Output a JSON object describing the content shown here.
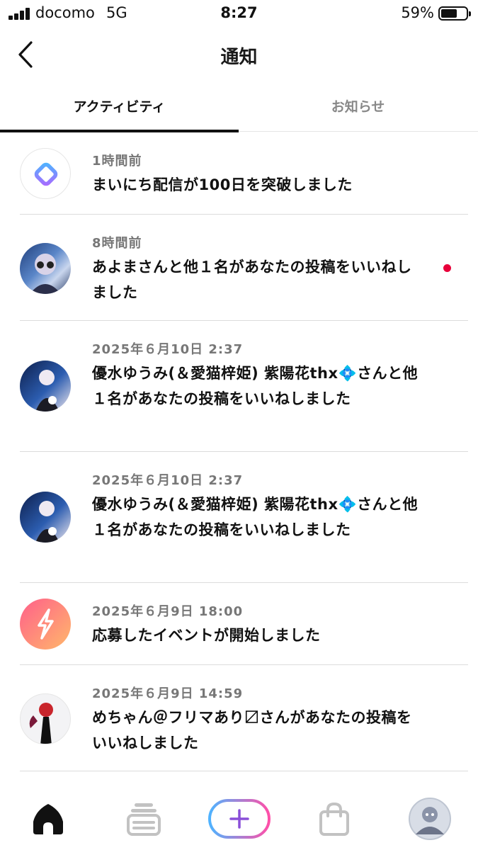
{
  "status_bar": {
    "carrier": "docomo",
    "network": "5G",
    "time": "8:27",
    "battery": "59%",
    "battery_level": 0.59
  },
  "header": {
    "title": "通知",
    "back_icon": "chevron-left-icon"
  },
  "tabs": [
    {
      "label": "アクティビティ",
      "active": true
    },
    {
      "label": "お知らせ",
      "active": false
    }
  ],
  "notifications": [
    {
      "time": "1時間前",
      "message": "まいにち配信が100日を突破しました",
      "avatar": "app-logo-icon",
      "unread": false
    },
    {
      "time": "8時間前",
      "message": "あよまさんと他１名があなたの投稿をいいねしました",
      "avatar": "user-avatar",
      "unread": true
    },
    {
      "time": "2025年６月10日 2:37",
      "message": "優水ゆうみ(＆愛猫梓姫) 紫陽花thx💠さんと他１名があなたの投稿をいいねしました",
      "avatar": "user-avatar",
      "unread": false
    },
    {
      "time": "2025年６月10日 2:37",
      "message": "優水ゆうみ(＆愛猫梓姫) 紫陽花thx💠さんと他１名があなたの投稿をいいねしました",
      "avatar": "user-avatar",
      "unread": false
    },
    {
      "time": "2025年６月9日 18:00",
      "message": "応募したイベントが開始しました",
      "avatar": "event-bolt-icon",
      "unread": false
    },
    {
      "time": "2025年６月9日 14:59",
      "message": "めちゃん＠フリマあり〼さんがあなたの投稿をいいねしました",
      "avatar": "user-avatar",
      "unread": false
    }
  ],
  "bottom_nav": [
    {
      "icon": "home-icon",
      "active": true
    },
    {
      "icon": "feed-stack-icon",
      "active": false
    },
    {
      "icon": "plus-icon",
      "active": false
    },
    {
      "icon": "shopping-bag-icon",
      "active": false
    },
    {
      "icon": "profile-avatar",
      "active": false
    }
  ],
  "colors": {
    "accent_gradient_start": "#4fb3ff",
    "accent_gradient_end": "#ff4fa8",
    "unread_dot": "#e8003a",
    "event_icon_start": "#ff5f8a",
    "event_icon_end": "#ffb86b"
  }
}
